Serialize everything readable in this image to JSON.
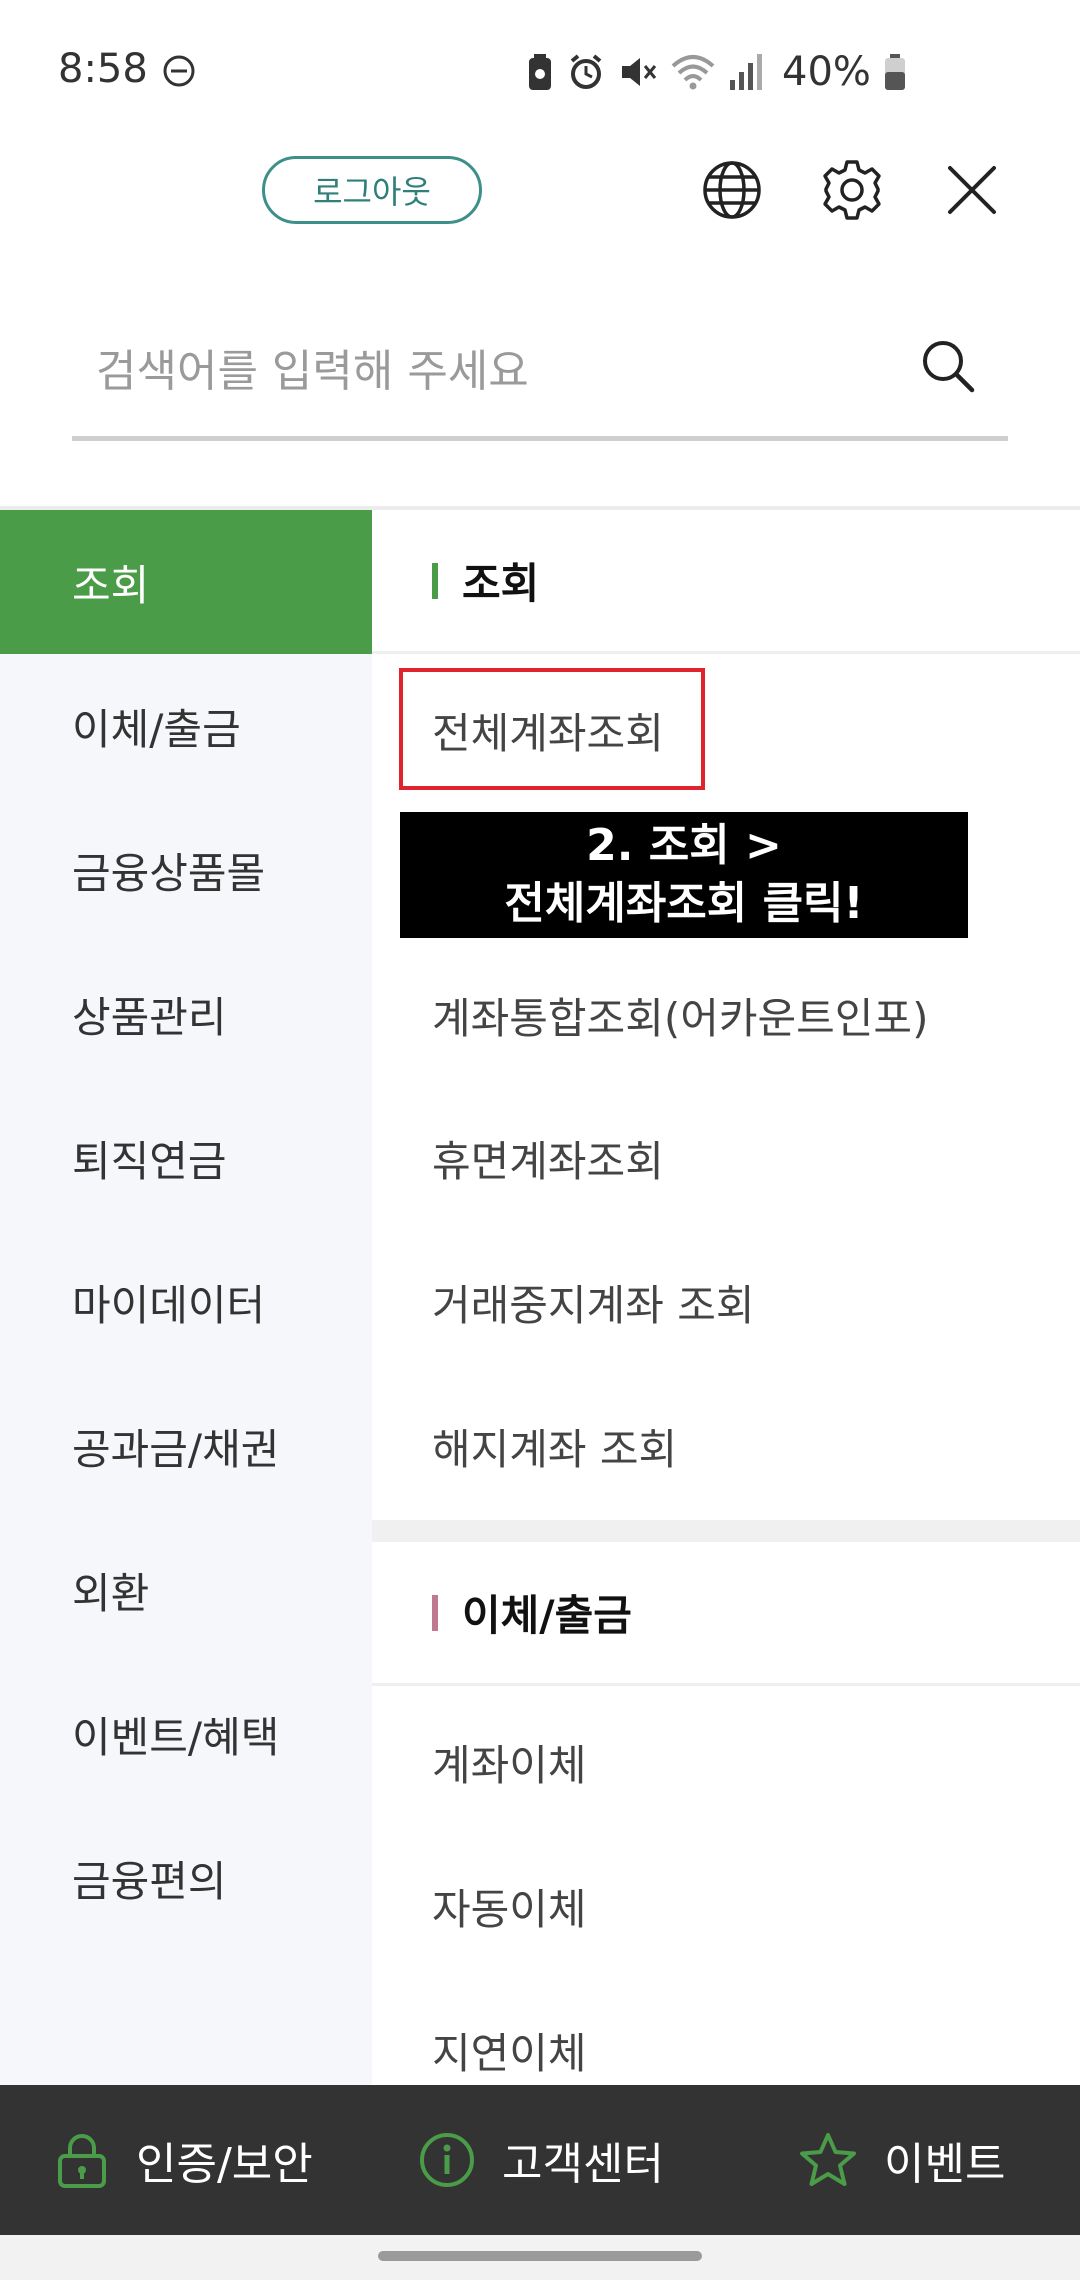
{
  "status_bar": {
    "time": "8:58",
    "battery_percent": "40%",
    "icons": [
      "dnd-icon",
      "battery-saver-icon",
      "alarm-icon",
      "mute-icon",
      "wifi-icon",
      "signal-icon",
      "battery-icon"
    ]
  },
  "header": {
    "logout_label": "로그아웃",
    "icons": [
      "globe-icon",
      "gear-icon",
      "close-icon"
    ]
  },
  "search": {
    "placeholder": "검색어를 입력해 주세요"
  },
  "sidebar": {
    "items": [
      {
        "label": "조회",
        "active": true
      },
      {
        "label": "이체/출금"
      },
      {
        "label": "금융상품몰"
      },
      {
        "label": "상품관리"
      },
      {
        "label": "퇴직연금"
      },
      {
        "label": "마이데이터"
      },
      {
        "label": "공과금/채권"
      },
      {
        "label": "외환"
      },
      {
        "label": "이벤트/혜택"
      },
      {
        "label": "금융편의"
      }
    ]
  },
  "content": {
    "section1": {
      "title": "조회",
      "bar_color": "#4a9c49",
      "links": [
        "전체계좌조회",
        "계좌통합조회(어카운트인포)",
        "휴면계좌조회",
        "거래중지계좌 조회",
        "해지계좌 조회"
      ]
    },
    "callout": {
      "line1": "2. 조회 >",
      "line2": "전체계좌조회 클릭!"
    },
    "section2": {
      "title": "이체/출금",
      "bar_color": "#c07a8f",
      "links": [
        "계좌이체",
        "자동이체",
        "지연이체"
      ]
    }
  },
  "bottom_bar": {
    "items": [
      {
        "label": "인증/보안",
        "icon": "lock-icon"
      },
      {
        "label": "고객센터",
        "icon": "info-icon"
      },
      {
        "label": "이벤트",
        "icon": "star-icon"
      }
    ]
  },
  "colors": {
    "accent_green": "#4a9c49",
    "logout_teal": "#3d8f8a",
    "highlight_red": "#e0242d",
    "bottom_bar_bg": "#333333"
  }
}
